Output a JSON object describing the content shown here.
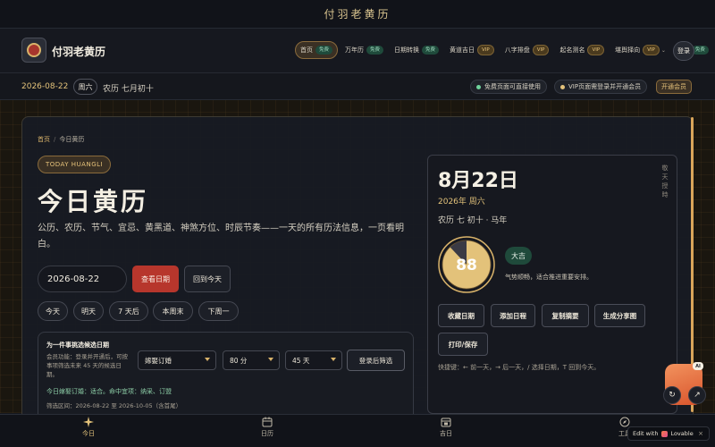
{
  "top": {
    "title": "付羽老黄历"
  },
  "brand": {
    "name": "付羽老黄历"
  },
  "nav": {
    "items": [
      {
        "label": "首页",
        "tag": "免费",
        "tag_type": "free"
      },
      {
        "label": "万年历",
        "tag": "免费",
        "tag_type": "free"
      },
      {
        "label": "日期转换",
        "tag": "免费",
        "tag_type": "free"
      },
      {
        "label": "黄道吉日",
        "tag": "VIP",
        "tag_type": "vip"
      },
      {
        "label": "八字排盘",
        "tag": "VIP",
        "tag_type": "vip"
      },
      {
        "label": "起名测名",
        "tag": "VIP",
        "tag_type": "vip"
      },
      {
        "label": "堪舆择向",
        "tag": "VIP",
        "tag_type": "vip"
      },
      {
        "label": "关于",
        "tag": "免费",
        "tag_type": "free"
      }
    ],
    "login": "登录"
  },
  "datebar": {
    "date": "2026-08-22",
    "weekday": "周六",
    "lunar": "农历 七月初十",
    "free_note": "免费页面可直接使用",
    "vip_note": "VIP页面需登录并开通会员",
    "vip_button": "开通会员"
  },
  "main": {
    "breadcrumb_home": "首页",
    "breadcrumb_sep": "/",
    "breadcrumb_current": "今日黄历",
    "badge": "TODAY HUANGLI",
    "title": "今日黄历",
    "description": "公历、农历、节气、宜忌、黄黑道、神煞方位、时辰节奏——一天的所有历法信息，一页看明白。",
    "date_value": "2026-08-22",
    "view_button": "查看日期",
    "today_button": "回到今天",
    "quick": [
      "今天",
      "明天",
      "7 天后",
      "本周末",
      "下周一"
    ]
  },
  "filter": {
    "title": "为一件事挑选候选日期",
    "note": "会员功能：登录并开通后，可按事项筛选未来 45 天的候选日期。",
    "event": "嫁娶订婚",
    "score": "80 分",
    "days": "45 天",
    "button": "登录后筛选",
    "result": "今日嫁娶订婚：适合。命中宜项：纳采、订盟",
    "range": "筛选区间：2026-08-22 至 2026-10-05（含首尾）"
  },
  "card": {
    "title": "8月22日",
    "year_weekday": "2026年 周六",
    "lunar": "农历 七 初十 · 马年",
    "vertical": "敬天授時",
    "score": "88",
    "verdict": "大吉",
    "verdict_note": "气势顺畅，适合推进重要安排。",
    "buttons": [
      "收藏日期",
      "添加日程",
      "复制摘要",
      "生成分享图",
      "打印/保存"
    ],
    "shortcuts": "快捷键：← 前一天，→ 后一天，/ 选择日期，T 回到今天。"
  },
  "bottom_tabs": [
    "今日",
    "日历",
    "吉日",
    "工具"
  ],
  "lovable": {
    "label": "Edit with",
    "brand": "Lovable",
    "close": "×"
  },
  "ai_badge": "AI",
  "colors": {
    "gold": "#e3c27a",
    "red": "#b7362c",
    "green": "#1f4a3b",
    "background": "#14161d"
  }
}
